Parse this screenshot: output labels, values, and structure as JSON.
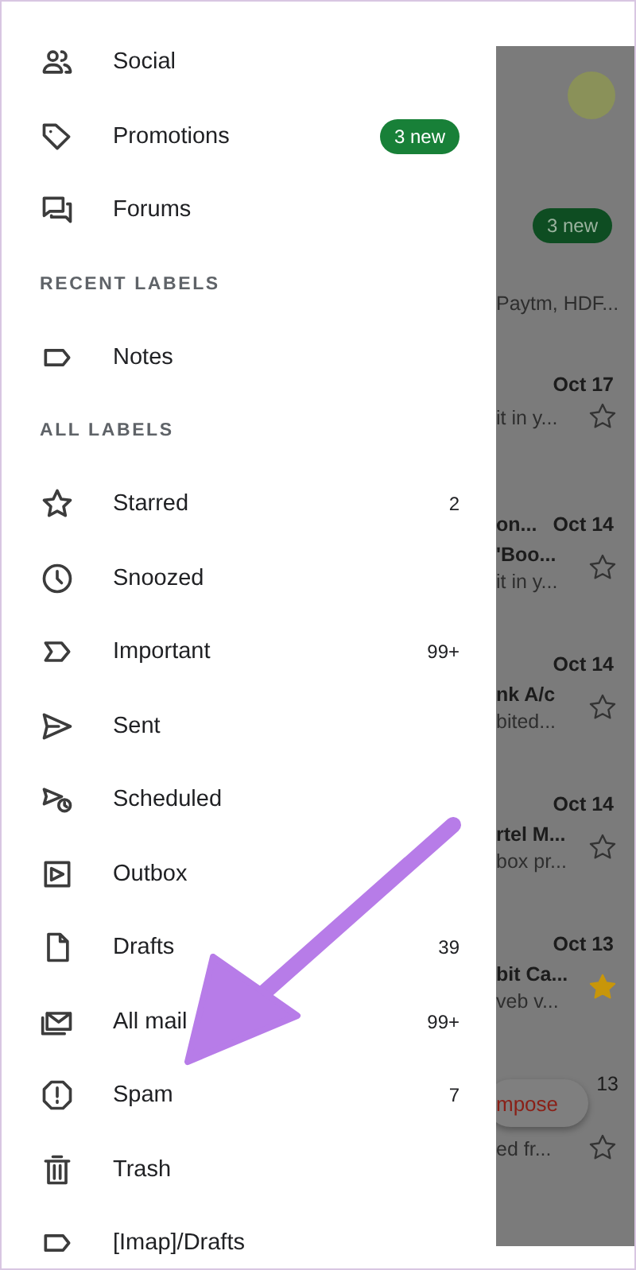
{
  "drawer": {
    "entries": [
      {
        "kind": "item",
        "label": "Social"
      },
      {
        "kind": "item",
        "label": "Promotions",
        "badge": "3 new"
      },
      {
        "kind": "item",
        "label": "Forums"
      },
      {
        "kind": "heading",
        "label": "RECENT LABELS"
      },
      {
        "kind": "item",
        "label": "Notes"
      },
      {
        "kind": "heading",
        "label": "ALL LABELS"
      },
      {
        "kind": "item",
        "label": "Starred",
        "count": "2"
      },
      {
        "kind": "item",
        "label": "Snoozed"
      },
      {
        "kind": "item",
        "label": "Important",
        "count": "99+"
      },
      {
        "kind": "item",
        "label": "Sent"
      },
      {
        "kind": "item",
        "label": "Scheduled"
      },
      {
        "kind": "item",
        "label": "Outbox"
      },
      {
        "kind": "item",
        "label": "Drafts",
        "count": "39"
      },
      {
        "kind": "item",
        "label": "All mail",
        "count": "99+"
      },
      {
        "kind": "item",
        "label": "Spam",
        "count": "7"
      },
      {
        "kind": "item",
        "label": "Trash"
      },
      {
        "kind": "item",
        "label": "[Imap]/Drafts"
      }
    ]
  },
  "background_list": {
    "category_badge": "3 new",
    "category_snippet": "Paytm, HDF...",
    "emails": [
      {
        "date": "Oct 17",
        "snippet": "it in y...",
        "starred": false
      },
      {
        "sender": "on...",
        "date": "Oct 14",
        "subject": "'Boo...",
        "snippet": "it in y...",
        "starred": false
      },
      {
        "date": "Oct 14",
        "subject": "nk A/c",
        "snippet": "bited...",
        "starred": false
      },
      {
        "date": "Oct 14",
        "subject": "rtel M...",
        "snippet": "box pr...",
        "starred": false
      },
      {
        "date": "Oct 13",
        "subject": "bit Ca...",
        "snippet": "veb v...",
        "starred": true
      },
      {
        "date": "13",
        "snippet": "ed fr...",
        "starred": false
      }
    ],
    "compose_button": "mpose"
  }
}
